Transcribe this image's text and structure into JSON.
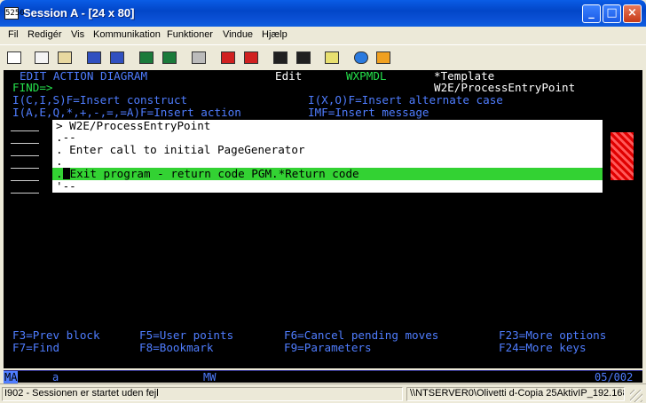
{
  "window": {
    "icon_text": "5250",
    "title": "Session A - [24 x 80]",
    "buttons": {
      "minimize": "_",
      "maximize": "□",
      "close": "×"
    }
  },
  "menu": [
    "Fil",
    "Redigér",
    "Vis",
    "Kommunikation",
    "Funktioner",
    "Vindue",
    "Hjælp"
  ],
  "toolbar_icons": [
    "print-icon",
    "copy-icon",
    "paste-icon",
    "send-icon",
    "receive-icon",
    "display-icon",
    "map-icon",
    "keyboard-icon",
    "record-macro-icon",
    "stop-macro-icon",
    "play-macro-icon",
    "macro-list-icon",
    "clipboard-icon",
    "globe-icon",
    "help-icon"
  ],
  "terminal": {
    "header_title": "EDIT ACTION DIAGRAM",
    "header_mode": "Edit",
    "header_model": "WXPMDL",
    "header_template": "*Template",
    "find_prompt": "FIND=>",
    "function_name": "W2E/ProcessEntryPoint",
    "help_line1_left": "I(C,I,S)F=Insert construct",
    "help_line1_right": "I(X,O)F=Insert alternate case",
    "help_line2_left": "I(A,E,Q,*,+,-,=,=A)F=Insert action",
    "help_line2_right": "IMF=Insert message",
    "popup": {
      "line1": "> W2E/ProcessEntryPoint",
      "line2": ".--",
      "line3": ". Enter call to initial PageGenerator",
      "line4": ".",
      "line5_prefix": ".",
      "line5": "Exit program - return code PGM.*Return code",
      "line6": "'--"
    },
    "fkeys": {
      "f3": "F3=Prev block",
      "f5": "F5=User points",
      "f6": "F6=Cancel pending moves",
      "f23": "F23=More options",
      "f7": "F7=Find",
      "f8": "F8=Bookmark",
      "f9": "F9=Parameters",
      "f24": "F24=More keys"
    }
  },
  "oia": {
    "ma": "MA",
    "a": "a",
    "mw": "MW",
    "position": "05/002"
  },
  "status": {
    "left": "I902 - Sessionen er startet uden fejl",
    "right": "\\\\NTSERVER0\\Olivetti d-Copia 25AktivIP_192.168."
  },
  "colors": {
    "terminal_bg": "#000000",
    "blue": "#4f7dff",
    "green": "#25e04b",
    "highlight": "#33d233"
  }
}
